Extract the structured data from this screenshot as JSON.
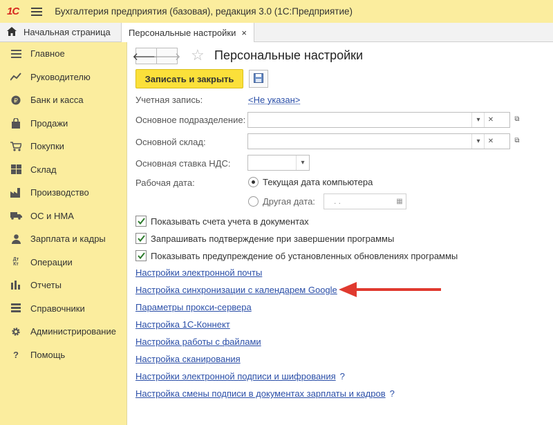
{
  "app": {
    "logo": "1С",
    "title": "Бухгалтерия предприятия (базовая), редакция 3.0  (1С:Предприятие)"
  },
  "tabs": [
    {
      "label": "Начальная страница"
    },
    {
      "label": "Персональные настройки",
      "close": "×"
    }
  ],
  "sidebar": {
    "items": [
      {
        "label": "Главное",
        "icon": "list-icon"
      },
      {
        "label": "Руководителю",
        "icon": "trend-icon"
      },
      {
        "label": "Банк и касса",
        "icon": "coin-icon"
      },
      {
        "label": "Продажи",
        "icon": "bag-icon"
      },
      {
        "label": "Покупки",
        "icon": "cart-icon"
      },
      {
        "label": "Склад",
        "icon": "grid-icon"
      },
      {
        "label": "Производство",
        "icon": "factory-icon"
      },
      {
        "label": "ОС и НМА",
        "icon": "truck-icon"
      },
      {
        "label": "Зарплата и кадры",
        "icon": "person-icon"
      },
      {
        "label": "Операции",
        "icon": "dt-kt-icon",
        "glyph": "Дт Кт"
      },
      {
        "label": "Отчеты",
        "icon": "bar-chart-icon"
      },
      {
        "label": "Справочники",
        "icon": "book-icon"
      },
      {
        "label": "Администрирование",
        "icon": "gear-icon"
      },
      {
        "label": "Помощь",
        "icon": "question-icon",
        "glyph": "?"
      }
    ]
  },
  "form": {
    "title": "Персональные настройки",
    "save_close_label": "Записать и закрыть",
    "account_label": "Учетная запись:",
    "account_value": "<Не указан>",
    "department_label": "Основное подразделение:",
    "warehouse_label": "Основной склад:",
    "vat_label": "Основная ставка НДС:",
    "workdate_label": "Рабочая дата:",
    "radio_current": "Текущая дата компьютера",
    "radio_other": "Другая дата:",
    "date_placeholder": ". .",
    "checkboxes": [
      "Показывать счета учета в документах",
      "Запрашивать подтверждение при завершении программы",
      "Показывать предупреждение об установленных обновлениях программы"
    ],
    "links": [
      "Настройки электронной почты",
      "Настройка синхронизации с календарем Google",
      "Параметры прокси-сервера",
      "Настройка 1С-Коннект",
      "Настройка работы с файлами",
      "Настройка сканирования",
      "Настройки электронной подписи и шифрования",
      "Настройка смены подписи в документах зарплаты и кадров"
    ],
    "help_glyph": "?"
  },
  "colors": {
    "sidebar_bg": "#fbed9e",
    "accent_button": "#fbe03a",
    "link": "#2b4fa8",
    "annotation_arrow": "#e03a2f",
    "logo": "#d6281f"
  }
}
